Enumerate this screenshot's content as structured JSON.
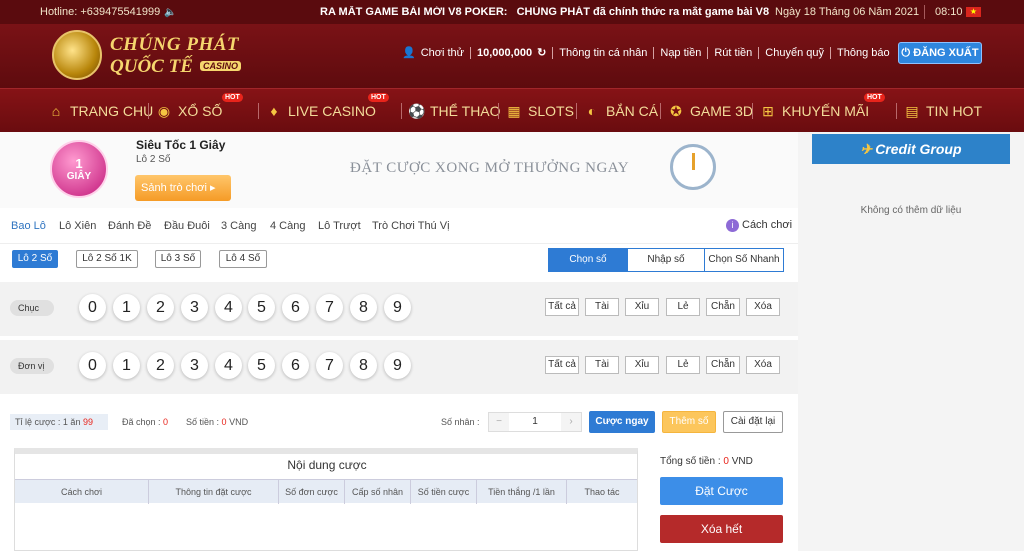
{
  "topbar": {
    "hotline": "Hotline: +639475541999",
    "speaker_icon": "speaker-icon",
    "marquee_title": "RA MẮT GAME BÀI MỚI V8 POKER:",
    "marquee_text": "CHÚNG PHÁT đã chính thức ra mắt game bài V8 POKE",
    "date": "Ngày 18 Tháng 06 Năm 2021",
    "time": "08:10",
    "flag_icon": "vietnam-flag-icon"
  },
  "header": {
    "logo_line1": "CHÚNG PHÁT",
    "logo_line2": "QUỐC TẾ",
    "logo_badge": "CASINO",
    "user_icon": "user-icon",
    "username": "Chơi thử",
    "balance": "10,000,000",
    "links": [
      "Thông tin cá nhân",
      "Nạp tiền",
      "Rút tiền",
      "Chuyển quỹ",
      "Thông báo"
    ],
    "logout": "ĐĂNG XUẤT"
  },
  "nav": {
    "items": [
      {
        "label": "TRANG CHU",
        "icon": "home-icon"
      },
      {
        "label": "XỔ SỐ",
        "icon": "lottery-ball-icon",
        "badge": "HOT"
      },
      {
        "label": "LIVE CASINO",
        "icon": "fire-icon",
        "badge": "HOT"
      },
      {
        "label": "THỂ THAO",
        "icon": "soccer-ball-icon"
      },
      {
        "label": "SLOTS",
        "icon": "slot-machine-icon"
      },
      {
        "label": "BẮN CÁ",
        "icon": "fish-icon"
      },
      {
        "label": "GAME 3D",
        "icon": "game-3d-icon"
      },
      {
        "label": "KHUYẾN MÃI",
        "icon": "gift-icon",
        "badge": "HOT"
      },
      {
        "label": "TIN HOT",
        "icon": "news-icon"
      }
    ]
  },
  "banner": {
    "ball_text_1": "1",
    "ball_text_2": "GIÂY",
    "game_name": "Siêu Tốc 1 Giây",
    "game_sub": "Lô 2 Số",
    "play_button": "Sảnh trò chơi ▸",
    "tagline": "ĐẶT CƯỢC XONG MỞ THƯỞNG NGAY"
  },
  "tabs": {
    "items": [
      "Bao Lô",
      "Lô Xiên",
      "Đánh Đề",
      "Đầu Đuôi",
      "3 Càng",
      "4 Càng",
      "Lô Trượt",
      "Trò Chơi Thú Vị"
    ],
    "active": "Bao Lô",
    "guide": "Cách chơi"
  },
  "subtabs": {
    "items": [
      "Lô 2 Số",
      "Lô 2 Số 1K",
      "Lô 3 Số",
      "Lô 4 Số"
    ],
    "active": "Lô 2 Số"
  },
  "modes": {
    "items": [
      "Chọn số",
      "Nhập số",
      "Chọn Số Nhanh"
    ],
    "active": "Chọn số"
  },
  "rows": [
    {
      "label": "Chục"
    },
    {
      "label": "Đơn vị"
    }
  ],
  "digits": [
    "0",
    "1",
    "2",
    "3",
    "4",
    "5",
    "6",
    "7",
    "8",
    "9"
  ],
  "quick": [
    "Tất cả",
    "Tài",
    "Xỉu",
    "Lẻ",
    "Chẵn",
    "Xóa"
  ],
  "info": {
    "rate_label": "Tỉ lệ cược : 1 ăn",
    "rate_value": "99",
    "chosen_label": "Đã chọn :",
    "chosen_value": "0",
    "amount_label": "Số tiền :",
    "amount_value": "0",
    "currency": "VND",
    "multiplier_label": "Số nhân :",
    "multiplier_value": "1"
  },
  "actions": {
    "bet_now": "Cược ngay",
    "add_number": "Thêm số",
    "reset": "Cài đặt lại"
  },
  "table": {
    "title": "Nội dung cược",
    "columns": [
      "Cách chơi",
      "Thông tin đặt cược",
      "Số đơn cược",
      "Cấp số nhân",
      "Số tiền cược",
      "Tiền thắng /1 lần",
      "Thao tác"
    ]
  },
  "summary": {
    "total_label": "Tổng số tiền :",
    "total_value": "0",
    "currency": "VND",
    "place_bet": "Đặt Cược",
    "clear_all": "Xóa hết"
  },
  "sidebar": {
    "brand": "Credit Group",
    "empty": "Không có thêm dữ liệu"
  },
  "colors": {
    "maroon": "#5a0b0e",
    "gold": "#f3dc9a",
    "blue": "#2e7bd4",
    "red_button": "#b52a2a"
  }
}
